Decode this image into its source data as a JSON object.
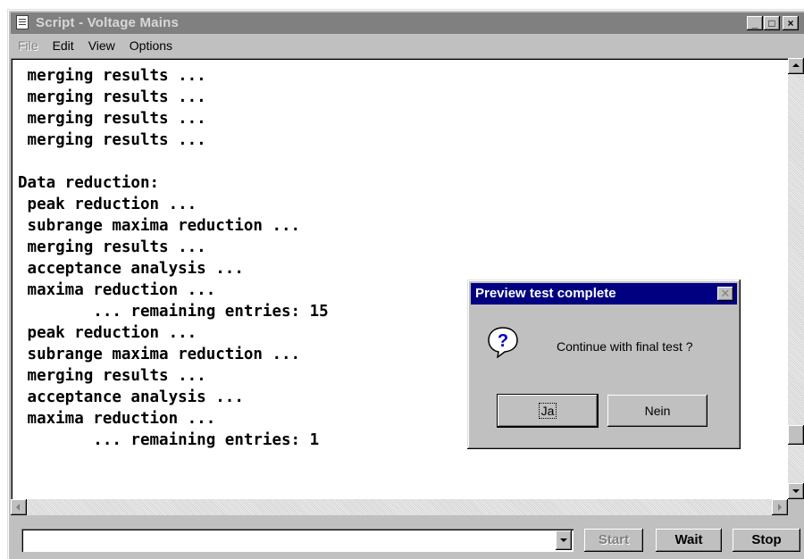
{
  "window": {
    "title": "Script - Voltage Mains",
    "min_glyph": "_",
    "max_glyph": "□",
    "close_glyph": "×"
  },
  "menu": {
    "file": "File",
    "edit": "Edit",
    "view": "View",
    "options": "Options"
  },
  "editor": {
    "text": " merging results ...\n merging results ...\n merging results ...\n merging results ...\n\nData reduction:\n peak reduction ...\n subrange maxima reduction ...\n merging results ...\n acceptance analysis ...\n maxima reduction ...\n        ... remaining entries: 15\n peak reduction ...\n subrange maxima reduction ...\n merging results ...\n acceptance analysis ...\n maxima reduction ...\n        ... remaining entries: 1"
  },
  "toolbar": {
    "command_value": "",
    "start_label": "Start",
    "wait_label": "Wait",
    "stop_label": "Stop"
  },
  "dialog": {
    "title": "Preview test complete",
    "message": "Continue with final test ?",
    "yes_label": "Ja",
    "no_label": "Nein",
    "icon": "question-icon"
  },
  "colors": {
    "dialog_titlebar": "#000080",
    "inactive_titlebar": "#808080",
    "face": "#c0c0c0"
  }
}
